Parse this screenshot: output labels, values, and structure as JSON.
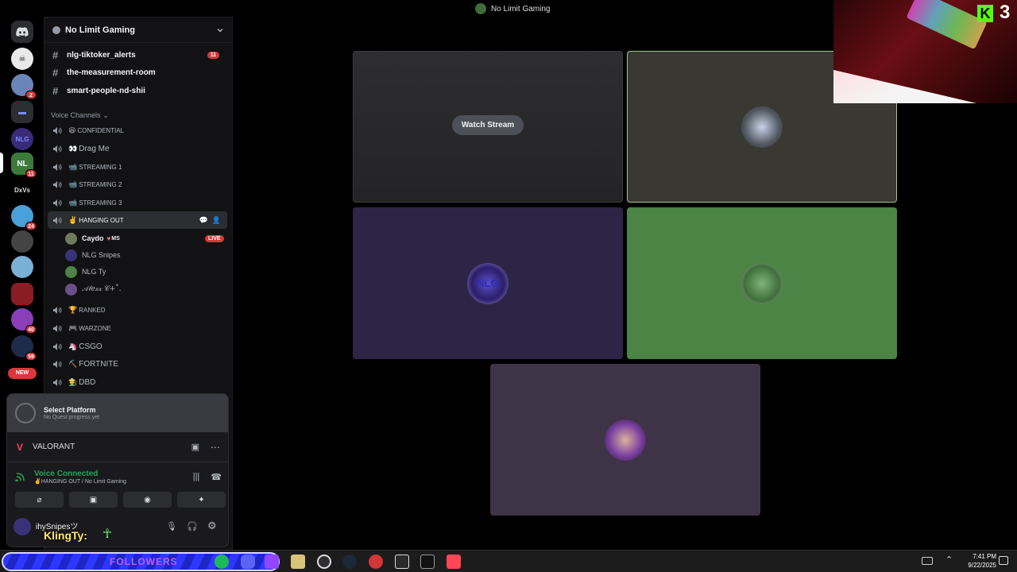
{
  "window_title": "No Limit Gaming",
  "server": {
    "name": "No Limit Gaming"
  },
  "server_rail": {
    "badges": [
      "2",
      "11",
      "24",
      "40",
      "59"
    ],
    "text_icons": [
      "NLG",
      "DxVs"
    ],
    "new_label": "NEW"
  },
  "text_channels": [
    {
      "name": "nlg-tiktoker_alerts",
      "badge": "11"
    },
    {
      "name": "the-measurement-room"
    },
    {
      "name": "smart-people-nd-shii"
    }
  ],
  "voice_category": "Voice Channels",
  "voice_channels": [
    {
      "emoji": "😆",
      "name": "CONFIDENTIAL",
      "small": true
    },
    {
      "emoji": "👀",
      "name": "Drag Me",
      "small": false
    },
    {
      "emoji": "📹",
      "name": "STREAMING 1",
      "small": true
    },
    {
      "emoji": "📹",
      "name": "STREAMING 2",
      "small": true
    },
    {
      "emoji": "📹",
      "name": "STREAMING 3",
      "small": true
    },
    {
      "emoji": "✌️",
      "name": "HANGING OUT",
      "small": true,
      "active": true
    },
    {
      "emoji": "🏆",
      "name": "RANKED",
      "small": true
    },
    {
      "emoji": "🎮",
      "name": "WARZONE",
      "small": true
    },
    {
      "emoji": "🦄",
      "name": "CSGO",
      "small": false
    },
    {
      "emoji": "⛏️",
      "name": "FORTNITE",
      "small": false
    },
    {
      "emoji": "👨‍🌾",
      "name": "DBD",
      "small": false
    }
  ],
  "members": [
    {
      "name": "Caydo",
      "tag": "MS",
      "live": "LIVE"
    },
    {
      "name": "NLG Snipes"
    },
    {
      "name": "NLG Ty"
    },
    {
      "name": "𝒜𝓁𝑒𝓍𝓍 𝒞+˚."
    }
  ],
  "quest": {
    "title": "Select Platform",
    "subtitle": "No Quest progress yet"
  },
  "activity": {
    "game": "VALORANT"
  },
  "voice_status": {
    "title": "Voice Connected",
    "channel": "✌️HANGING OUT / No Limit Gaming"
  },
  "user": {
    "name": "ihySnipesツ",
    "overlay_name": "KlingTy:"
  },
  "stream": {
    "watch_label": "Watch Stream"
  },
  "overlay": {
    "count": "3",
    "followers_label": "FOLLOWERS"
  },
  "taskbar": {
    "time": "7:41 PM",
    "date": "9/22/2025"
  },
  "colors": {
    "tile_gray": "#3a3832",
    "tile_purple": "#2c2546",
    "tile_green": "#4b8444",
    "tile_mauve": "#3e3347",
    "live_red": "#da373c",
    "connected_green": "#23a55a"
  }
}
